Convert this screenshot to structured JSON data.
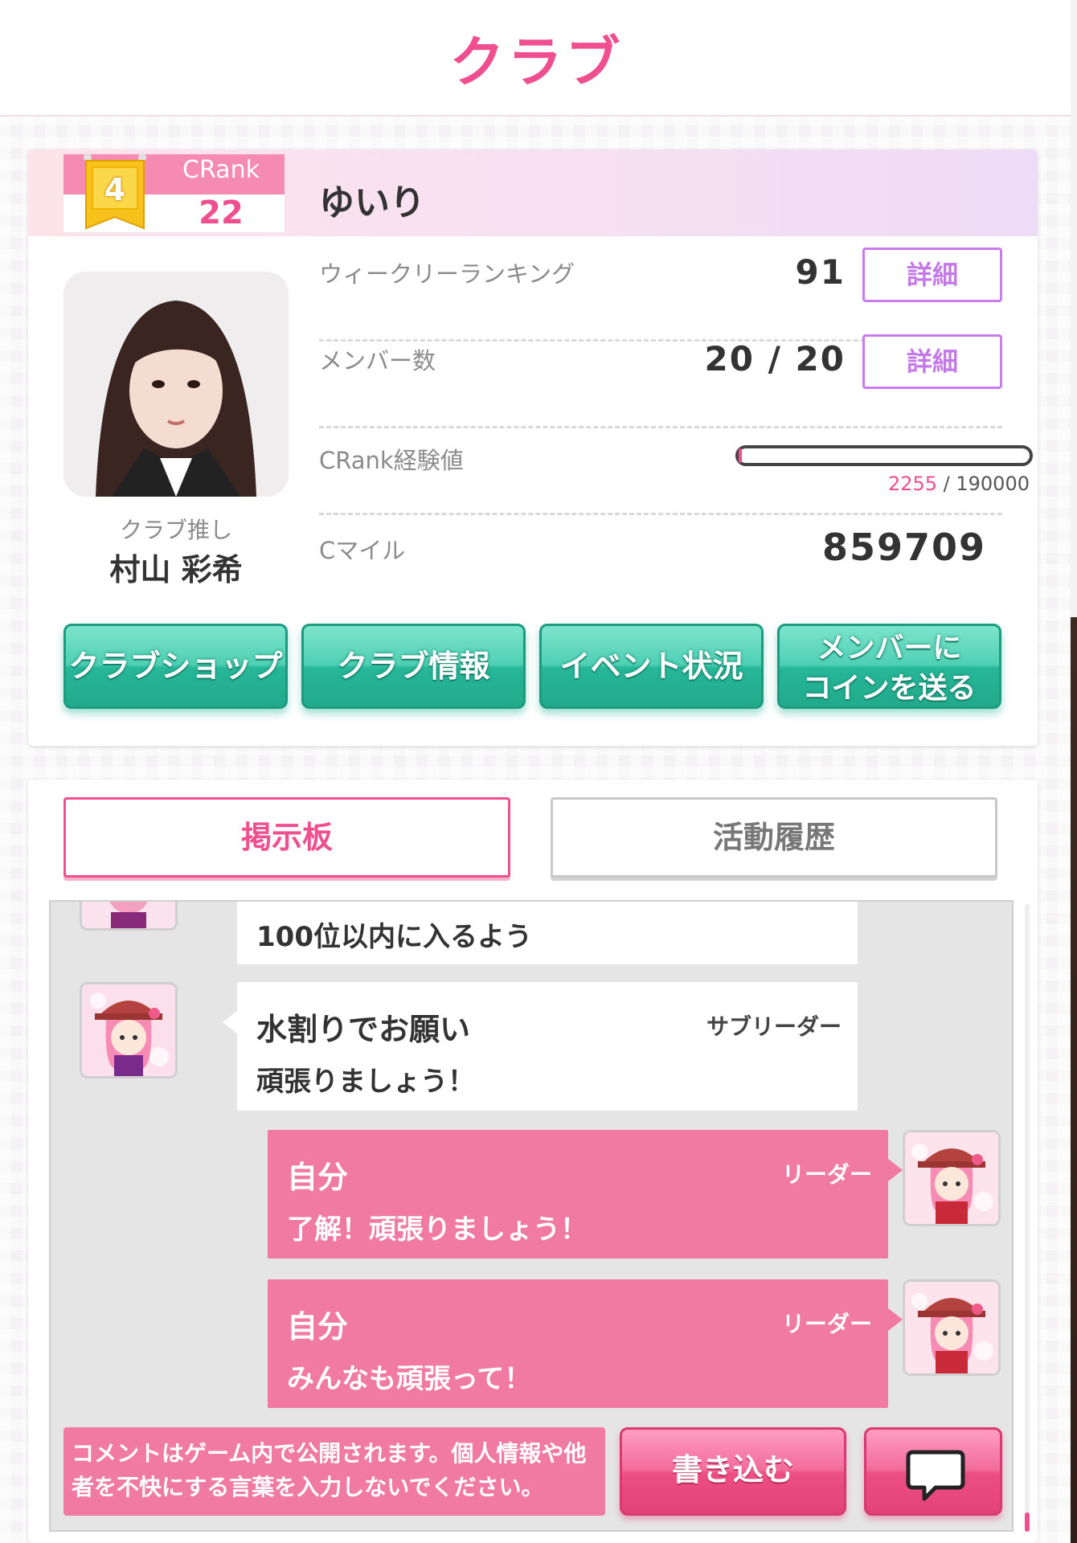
{
  "header": {
    "title": "クラブ"
  },
  "club": {
    "crank_label": "CRank",
    "crank_value": "22",
    "badge_number": "4",
    "name": "ゆいり",
    "oshi_label": "クラブ推し",
    "oshi_name": "村山 彩希"
  },
  "stats": {
    "weekly_label": "ウィークリーランキング",
    "weekly_value": "91",
    "members_label": "メンバー数",
    "members_value": "20 / 20",
    "exp_label": "CRank経験値",
    "exp_current": "2255",
    "exp_separator": " / ",
    "exp_max": "190000",
    "exp_fraction": 0.0119,
    "mile_label": "Cマイル",
    "mile_value": "859709",
    "detail_label": "詳細"
  },
  "actions": {
    "shop": "クラブショップ",
    "info": "クラブ情報",
    "event": "イベント状況",
    "send_line1": "メンバーに",
    "send_line2": "コインを送る"
  },
  "tabs": {
    "board": "掲示板",
    "history": "活動履歴"
  },
  "messages": [
    {
      "msg": "100位以内に入るよう"
    },
    {
      "name": "水割りでお願い",
      "role": "サブリーダー",
      "msg": "頑張りましょう！"
    },
    {
      "name": "自分",
      "role": "リーダー",
      "msg": "了解！頑張りましょう！"
    },
    {
      "name": "自分",
      "role": "リーダー",
      "msg": "みんなも頑張って！"
    }
  ],
  "footer": {
    "notice": "コメントはゲーム内で公開されます。個人情報や他者を不快にする言葉を入力しないでください。",
    "write_button": "書き込む"
  },
  "colors": {
    "accent": "#ef4f8e",
    "teal": "#27b799",
    "bubble_self": "#f07aa2",
    "detail_border": "#c97cf0"
  }
}
